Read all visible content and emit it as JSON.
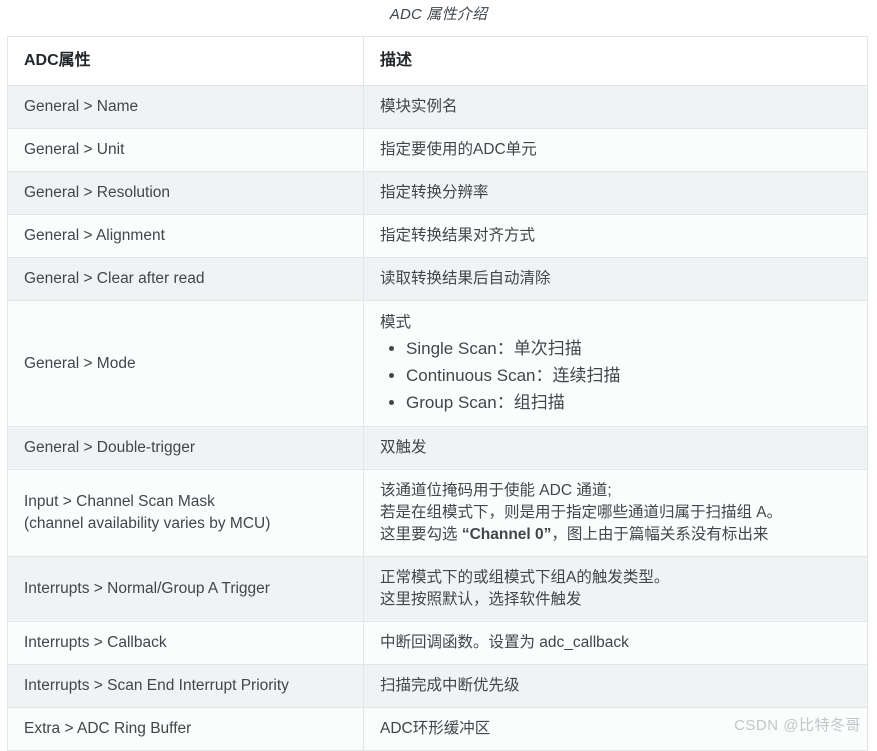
{
  "caption": "ADC 属性介绍",
  "table": {
    "columns": [
      {
        "key": "property",
        "label": "ADC属性"
      },
      {
        "key": "description",
        "label": "描述"
      }
    ],
    "rows": [
      {
        "property": "General > Name",
        "description": "模块实例名"
      },
      {
        "property": "General > Unit",
        "description": "指定要使用的ADC单元"
      },
      {
        "property": "General > Resolution",
        "description": "指定转换分辨率"
      },
      {
        "property": "General > Alignment",
        "description": "指定转换结果对齐方式"
      },
      {
        "property": "General > Clear after read",
        "description": "读取转换结果后自动清除"
      },
      {
        "property": "General > Mode",
        "description_heading": "模式",
        "description_items": [
          "Single Scan：单次扫描",
          "Continuous Scan：连续扫描",
          "Group Scan：组扫描"
        ]
      },
      {
        "property": "General > Double-trigger",
        "description": "双触发"
      },
      {
        "property_line1": "Input > Channel Scan Mask",
        "property_line2": "(channel availability varies by MCU)",
        "description_line1": "该通道位掩码用于使能 ADC 通道;",
        "description_line2": "若是在组模式下，则是用于指定哪些通道归属于扫描组 A。",
        "description_line3_pre": "这里要勾选 ",
        "description_line3_bold": "“Channel 0”",
        "description_line3_post": "，图上由于篇幅关系没有标出来"
      },
      {
        "property": "Interrupts > Normal/Group A Trigger",
        "description_line1": "正常模式下的或组模式下组A的触发类型。",
        "description_line2": "这里按照默认，选择软件触发"
      },
      {
        "property": "Interrupts > Callback",
        "description": "中断回调函数。设置为 adc_callback"
      },
      {
        "property": "Interrupts > Scan End Interrupt Priority",
        "description": "扫描完成中断优先级"
      },
      {
        "property": "Extra > ADC Ring Buffer",
        "description": "ADC环形缓冲区"
      }
    ]
  },
  "watermark": "CSDN @比特冬哥",
  "colors": {
    "text": "#41464b",
    "header_text": "#23272b",
    "border": "#e3e6e8",
    "stripe": "#f0f3f4",
    "plain": "#fbfcfc",
    "watermark": "#c3c6c9"
  }
}
